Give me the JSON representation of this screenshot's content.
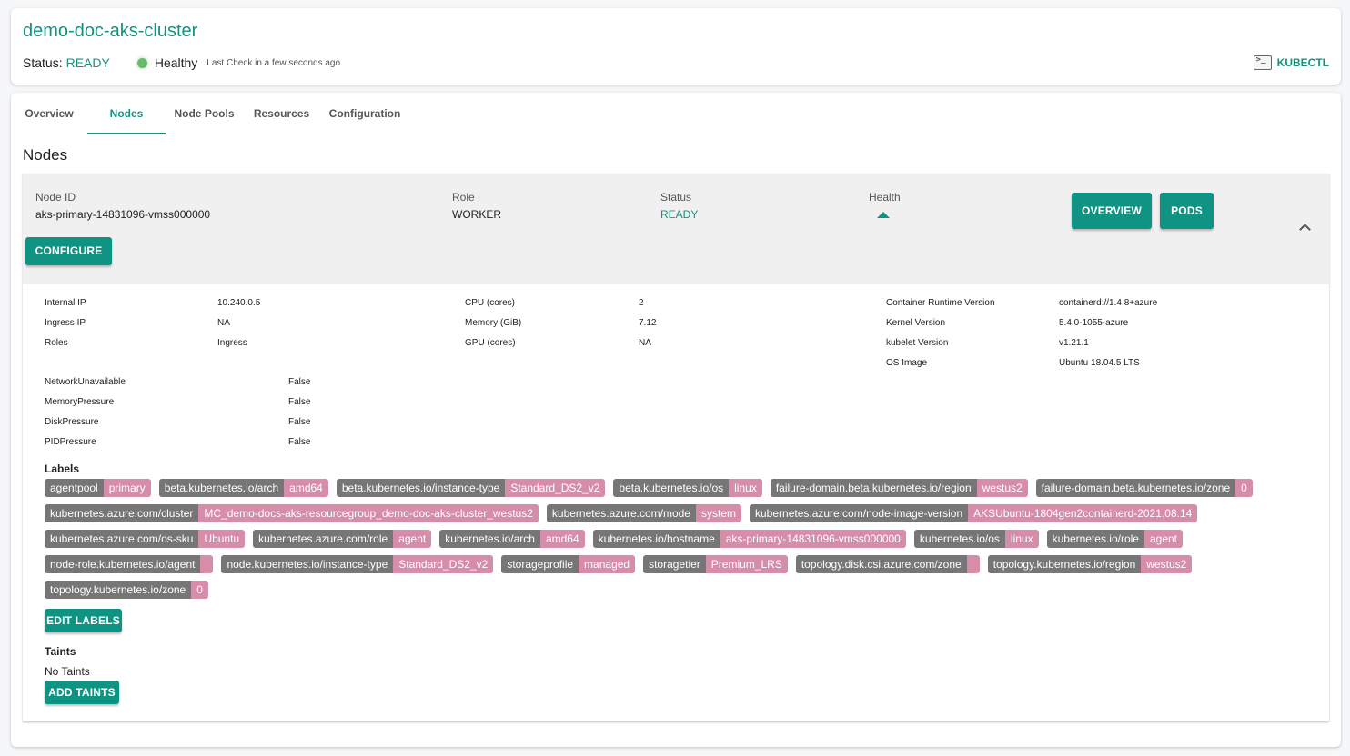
{
  "header": {
    "cluster_name": "demo-doc-aks-cluster",
    "status_label": "Status:",
    "status_value": "READY",
    "health": "Healthy",
    "last_check": "Last Check in a few seconds ago",
    "kubectl_label": "KUBECTL",
    "colors": {
      "accent": "#13927f",
      "healthy": "#66bb6a"
    }
  },
  "tabs": [
    {
      "label": "Overview",
      "active": false
    },
    {
      "label": "Nodes",
      "active": true
    },
    {
      "label": "Node Pools",
      "active": false
    },
    {
      "label": "Resources",
      "active": false
    },
    {
      "label": "Configuration",
      "active": false
    }
  ],
  "section_title": "Nodes",
  "node": {
    "id_label": "Node ID",
    "id": "aks-primary-14831096-vmss000000",
    "role_label": "Role",
    "role": "WORKER",
    "status_label": "Status",
    "status": "READY",
    "health_label": "Health",
    "health_icon": "triangle-up-icon",
    "buttons": {
      "overview": "OVERVIEW",
      "pods": "PODS",
      "configure": "CONFIGURE"
    },
    "info_col1": [
      {
        "label": "Internal IP",
        "value": "10.240.0.5"
      },
      {
        "label": "Ingress IP",
        "value": "NA"
      },
      {
        "label": "Roles",
        "value": "Ingress"
      }
    ],
    "info_col2": [
      {
        "label": "CPU (cores)",
        "value": "2"
      },
      {
        "label": "Memory (GiB)",
        "value": "7.12"
      },
      {
        "label": "GPU (cores)",
        "value": "NA"
      }
    ],
    "info_col3": [
      {
        "label": "Container Runtime Version",
        "value": "containerd://1.4.8+azure"
      },
      {
        "label": "Kernel Version",
        "value": "5.4.0-1055-azure"
      },
      {
        "label": "kubelet Version",
        "value": "v1.21.1"
      },
      {
        "label": "OS Image",
        "value": "Ubuntu 18.04.5 LTS"
      }
    ],
    "conditions": [
      {
        "label": "NetworkUnavailable",
        "value": "False"
      },
      {
        "label": "MemoryPressure",
        "value": "False"
      },
      {
        "label": "DiskPressure",
        "value": "False"
      },
      {
        "label": "PIDPressure",
        "value": "False"
      }
    ],
    "labels_title": "Labels",
    "labels": [
      {
        "key": "agentpool",
        "value": "primary"
      },
      {
        "key": "beta.kubernetes.io/arch",
        "value": "amd64"
      },
      {
        "key": "beta.kubernetes.io/instance-type",
        "value": "Standard_DS2_v2"
      },
      {
        "key": "beta.kubernetes.io/os",
        "value": "linux"
      },
      {
        "key": "failure-domain.beta.kubernetes.io/region",
        "value": "westus2"
      },
      {
        "key": "failure-domain.beta.kubernetes.io/zone",
        "value": "0"
      },
      {
        "key": "kubernetes.azure.com/cluster",
        "value": "MC_demo-docs-aks-resourcegroup_demo-doc-aks-cluster_westus2"
      },
      {
        "key": "kubernetes.azure.com/mode",
        "value": "system"
      },
      {
        "key": "kubernetes.azure.com/node-image-version",
        "value": "AKSUbuntu-1804gen2containerd-2021.08.14"
      },
      {
        "key": "kubernetes.azure.com/os-sku",
        "value": "Ubuntu"
      },
      {
        "key": "kubernetes.azure.com/role",
        "value": "agent"
      },
      {
        "key": "kubernetes.io/arch",
        "value": "amd64"
      },
      {
        "key": "kubernetes.io/hostname",
        "value": "aks-primary-14831096-vmss000000"
      },
      {
        "key": "kubernetes.io/os",
        "value": "linux"
      },
      {
        "key": "kubernetes.io/role",
        "value": "agent"
      },
      {
        "key": "node-role.kubernetes.io/agent",
        "value": ""
      },
      {
        "key": "node.kubernetes.io/instance-type",
        "value": "Standard_DS2_v2"
      },
      {
        "key": "storageprofile",
        "value": "managed"
      },
      {
        "key": "storagetier",
        "value": "Premium_LRS"
      },
      {
        "key": "topology.disk.csi.azure.com/zone",
        "value": ""
      },
      {
        "key": "topology.kubernetes.io/region",
        "value": "westus2"
      },
      {
        "key": "topology.kubernetes.io/zone",
        "value": "0"
      }
    ],
    "edit_labels": "EDIT LABELS",
    "taints_title": "Taints",
    "no_taints": "No Taints",
    "add_taints": "ADD TAINTS"
  }
}
